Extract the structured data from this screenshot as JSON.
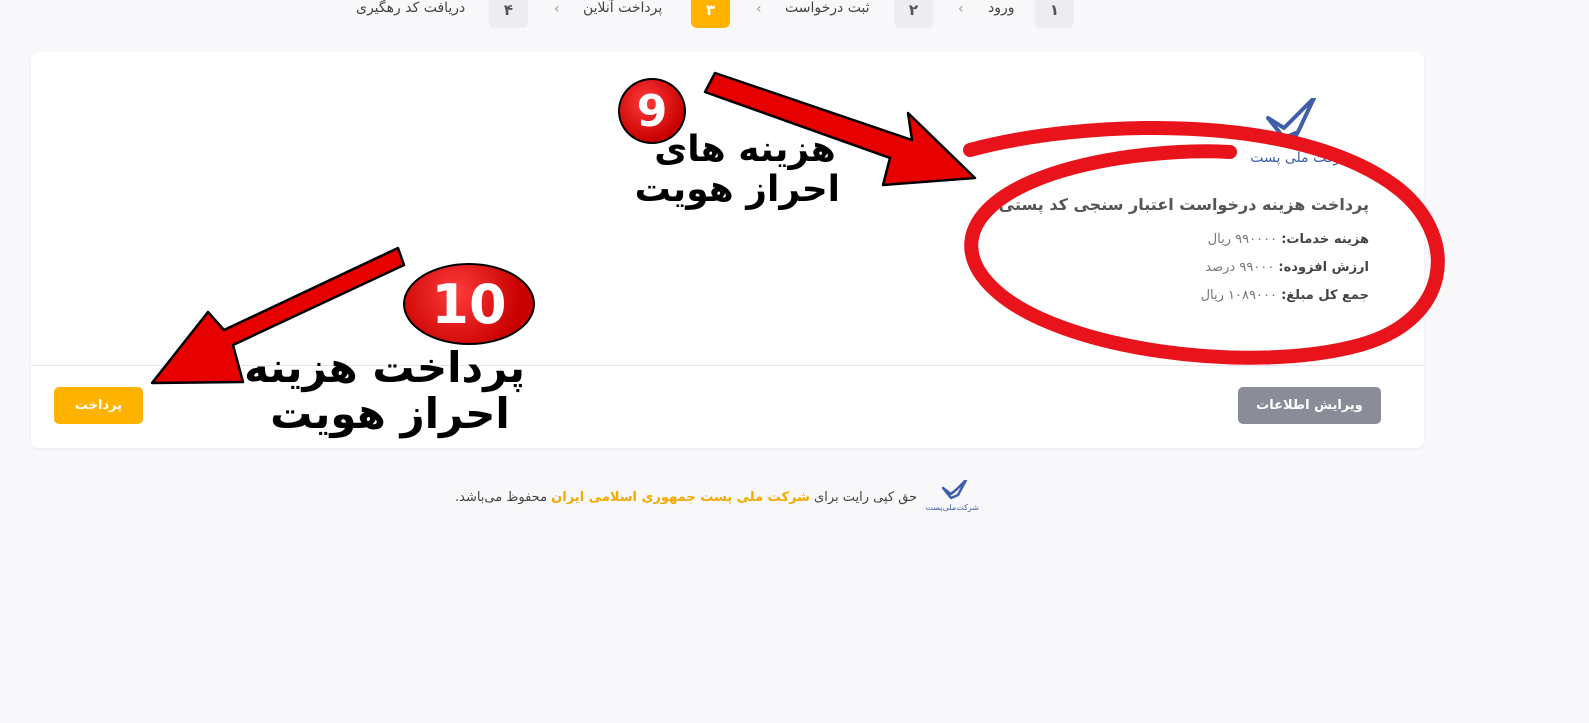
{
  "stepper": {
    "steps": [
      {
        "num": "۱",
        "label": "ورود",
        "active": false
      },
      {
        "num": "۲",
        "label": "ثبت درخواست",
        "active": false
      },
      {
        "num": "۳",
        "label": "پرداخت آنلاین",
        "active": true
      },
      {
        "num": "۴",
        "label": "دریافت کد رهگیری",
        "active": false
      }
    ],
    "chevron": "‹"
  },
  "card": {
    "logo_text": "شرکت ملی پست",
    "title": "پرداخت هزینه درخواست اعتبار سنجی کد پستی",
    "rows": [
      {
        "label": "هزینه خدمات:",
        "value": "۹۹۰۰۰۰ ریال"
      },
      {
        "label": "ارزش افزوده:",
        "value": "۹۹۰۰۰ درصد"
      },
      {
        "label": "جمع کل مبلغ:",
        "value": "۱۰۸۹۰۰۰ ریال"
      }
    ],
    "edit_button": "ویرایش اطلاعات",
    "pay_button": "پرداخت"
  },
  "footer": {
    "prefix": "حق کپی رایت برای",
    "brand": "شرکت ملی پست جمهوری اسلامی ایران",
    "suffix": "محفوظ می‌باشد.",
    "logo_text": "شرکت‌ملی‌پست"
  },
  "annotations": {
    "badge_9": "9",
    "text_9_line1": "هزینه های",
    "text_9_line2": "احراز هویت",
    "badge_10": "10",
    "text_10_line1": "پرداخت هزینه",
    "text_10_line2": "احراز هویت"
  },
  "colors": {
    "accent": "#ffb300",
    "edit_button": "#8a8d98",
    "annotation_red": "#e60000",
    "logo_blue": "#3f5fa8"
  }
}
